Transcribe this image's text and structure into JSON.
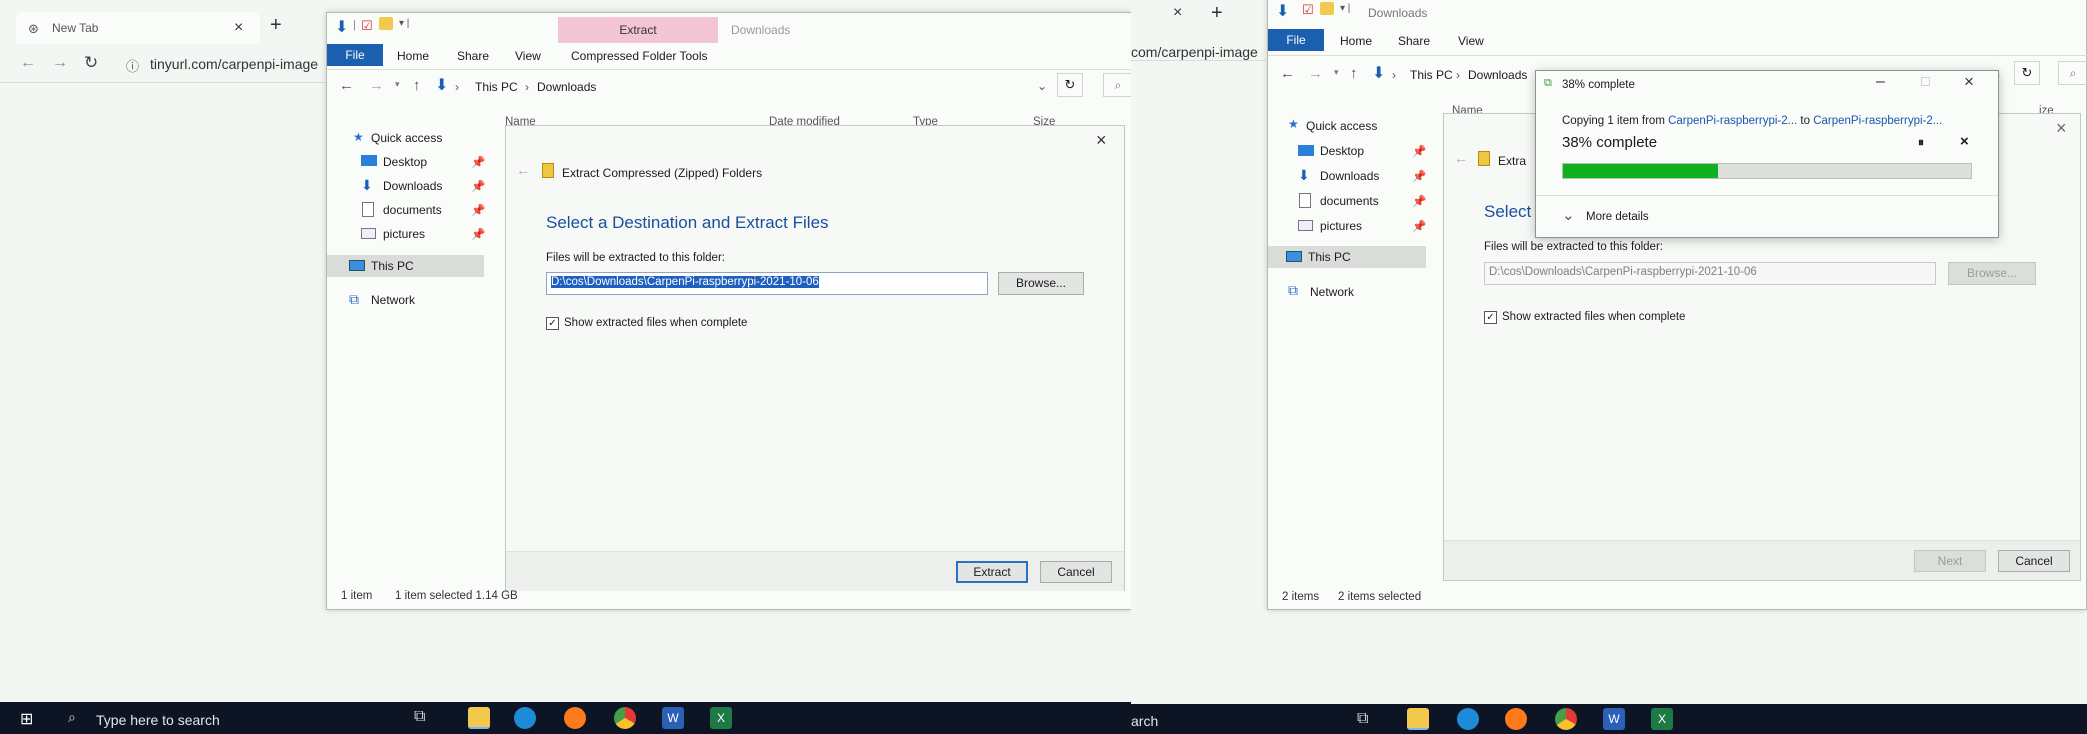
{
  "left": {
    "browser": {
      "tab_title": "New Tab",
      "address": "tinyurl.com/carpenpi-image"
    },
    "explorer": {
      "qat_title": "",
      "ribbon_tabs": [
        "File",
        "Home",
        "Share",
        "View"
      ],
      "context_group": "Extract",
      "context_tab": "Compressed Folder Tools",
      "window_title": "Downloads",
      "breadcrumb": [
        "This PC",
        "Downloads"
      ],
      "columns": [
        "Name",
        "Date modified",
        "Type",
        "Size"
      ],
      "nav": {
        "quick_access": "Quick access",
        "desktop": "Desktop",
        "downloads": "Downloads",
        "documents": "documents",
        "pictures": "pictures",
        "this_pc": "This PC",
        "network": "Network"
      },
      "status": {
        "items": "1 item",
        "selected": "1 item selected  1.14 GB"
      }
    },
    "wizard": {
      "title": "Extract Compressed (Zipped) Folders",
      "heading": "Select a Destination and Extract Files",
      "label": "Files will be extracted to this folder:",
      "path": "D:\\cos\\Downloads\\CarpenPi-raspberrypi-2021-10-06",
      "browse": "Browse...",
      "show_files": "Show extracted files when complete",
      "extract": "Extract",
      "cancel": "Cancel"
    },
    "taskbar": {
      "search": "Type here to search"
    }
  },
  "right": {
    "browser": {
      "tab_title": "New Tab",
      "address": "com/carpenpi-image"
    },
    "explorer": {
      "qat_title": "Downloads",
      "ribbon_tabs": [
        "File",
        "Home",
        "Share",
        "View"
      ],
      "breadcrumb": [
        "This PC",
        "Downloads"
      ],
      "columns": [
        "Name",
        "ize"
      ],
      "nav": {
        "quick_access": "Quick access",
        "desktop": "Desktop",
        "downloads": "Downloads",
        "documents": "documents",
        "pictures": "pictures",
        "this_pc": "This PC",
        "network": "Network"
      },
      "status": {
        "items": "2 items",
        "selected": "2 items selected"
      }
    },
    "wizard": {
      "title": "Extra",
      "heading": "Select",
      "label": "Files will be extracted to this folder:",
      "path": "D:\\cos\\Downloads\\CarpenPi-raspberrypi-2021-10-06",
      "browse": "Browse...",
      "show_files": "Show extracted files when complete",
      "next": "Next",
      "cancel": "Cancel"
    },
    "copy": {
      "title": "38% complete",
      "line_prefix": "Copying 1 item from",
      "source": "CarpenPi-raspberrypi-2...",
      "to": "to",
      "dest": "CarpenPi-raspberrypi-2...",
      "percent_text": "38% complete",
      "progress": 0.38,
      "more_details": "More details"
    },
    "taskbar": {
      "search": "arch"
    }
  },
  "colors": {
    "accent": "#1a5fb0",
    "progress": "#10b020",
    "context_tab": "#f4c5d4",
    "taskbar": "#0d1524"
  }
}
